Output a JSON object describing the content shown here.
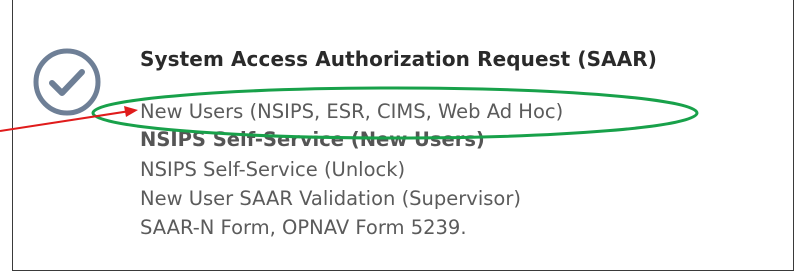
{
  "panel": {
    "title": "System Access Authorization Request (SAAR)",
    "icon": "check-circle-icon",
    "links": [
      {
        "label": "New Users (NSIPS, ESR, CIMS, Web Ad Hoc)",
        "bold": false
      },
      {
        "label": "NSIPS Self-Service (New Users)",
        "bold": true
      },
      {
        "label": "NSIPS Self-Service (Unlock)",
        "bold": false
      },
      {
        "label": "New User SAAR Validation (Supervisor)",
        "bold": false
      },
      {
        "label": "SAAR-N Form, OPNAV Form 5239.",
        "bold": false
      }
    ]
  },
  "annotations": {
    "highlight_color": "#18a14a",
    "arrow_color": "#e01b1b",
    "icon_color": "#6e7f96"
  }
}
